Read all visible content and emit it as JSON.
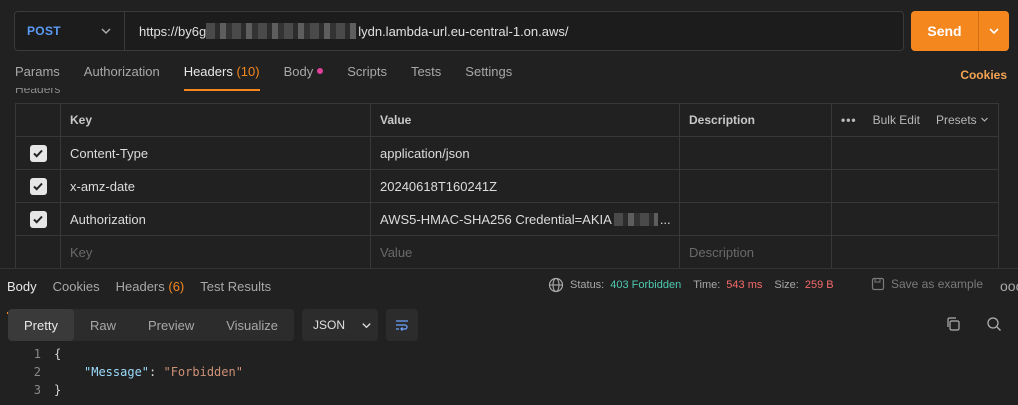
{
  "request": {
    "method": "POST",
    "url_prefix": "https://by6g",
    "url_suffix": "lydn.lambda-url.eu-central-1.on.aws/",
    "send_label": "Send"
  },
  "tabs": [
    {
      "label": "Params"
    },
    {
      "label": "Authorization"
    },
    {
      "label": "Headers",
      "count": "(10)"
    },
    {
      "label": "Body"
    },
    {
      "label": "Scripts"
    },
    {
      "label": "Tests"
    },
    {
      "label": "Settings"
    }
  ],
  "cookies_label": "Cookies",
  "hidden_headers_label": "Headers",
  "table": {
    "col_key": "Key",
    "col_value": "Value",
    "col_description": "Description",
    "bulk_edit": "Bulk Edit",
    "presets": "Presets",
    "rows": [
      {
        "key": "Content-Type",
        "value": "application/json"
      },
      {
        "key": "x-amz-date",
        "value": "20240618T160241Z"
      },
      {
        "key": "Authorization",
        "value": "AWS5-HMAC-SHA256 Credential=AKIA"
      }
    ],
    "value_ellipsis": "...",
    "placeholder_key": "Key",
    "placeholder_value": "Value",
    "placeholder_description": "Description"
  },
  "response": {
    "tabs": [
      {
        "label": "Body"
      },
      {
        "label": "Cookies"
      },
      {
        "label": "Headers",
        "count": "(6)"
      },
      {
        "label": "Test Results"
      }
    ],
    "status_label": "Status:",
    "status_value": "403 Forbidden",
    "time_label": "Time:",
    "time_value": "543 ms",
    "size_label": "Size:",
    "size_value": "259 B",
    "save_example": "Save as example",
    "more": "ooo",
    "views": [
      "Pretty",
      "Raw",
      "Preview",
      "Visualize"
    ],
    "format": "JSON",
    "code": {
      "line_numbers": [
        "1",
        "2",
        "3"
      ],
      "open_brace": "{",
      "key": "\"Message\"",
      "colon": ": ",
      "value": "\"Forbidden\"",
      "close_brace": "}"
    }
  },
  "colors": {
    "accent": "#f5871f",
    "method": "#5b9bf5",
    "status_ok": "#4ec9b0",
    "status_bad": "#f56a6a"
  }
}
